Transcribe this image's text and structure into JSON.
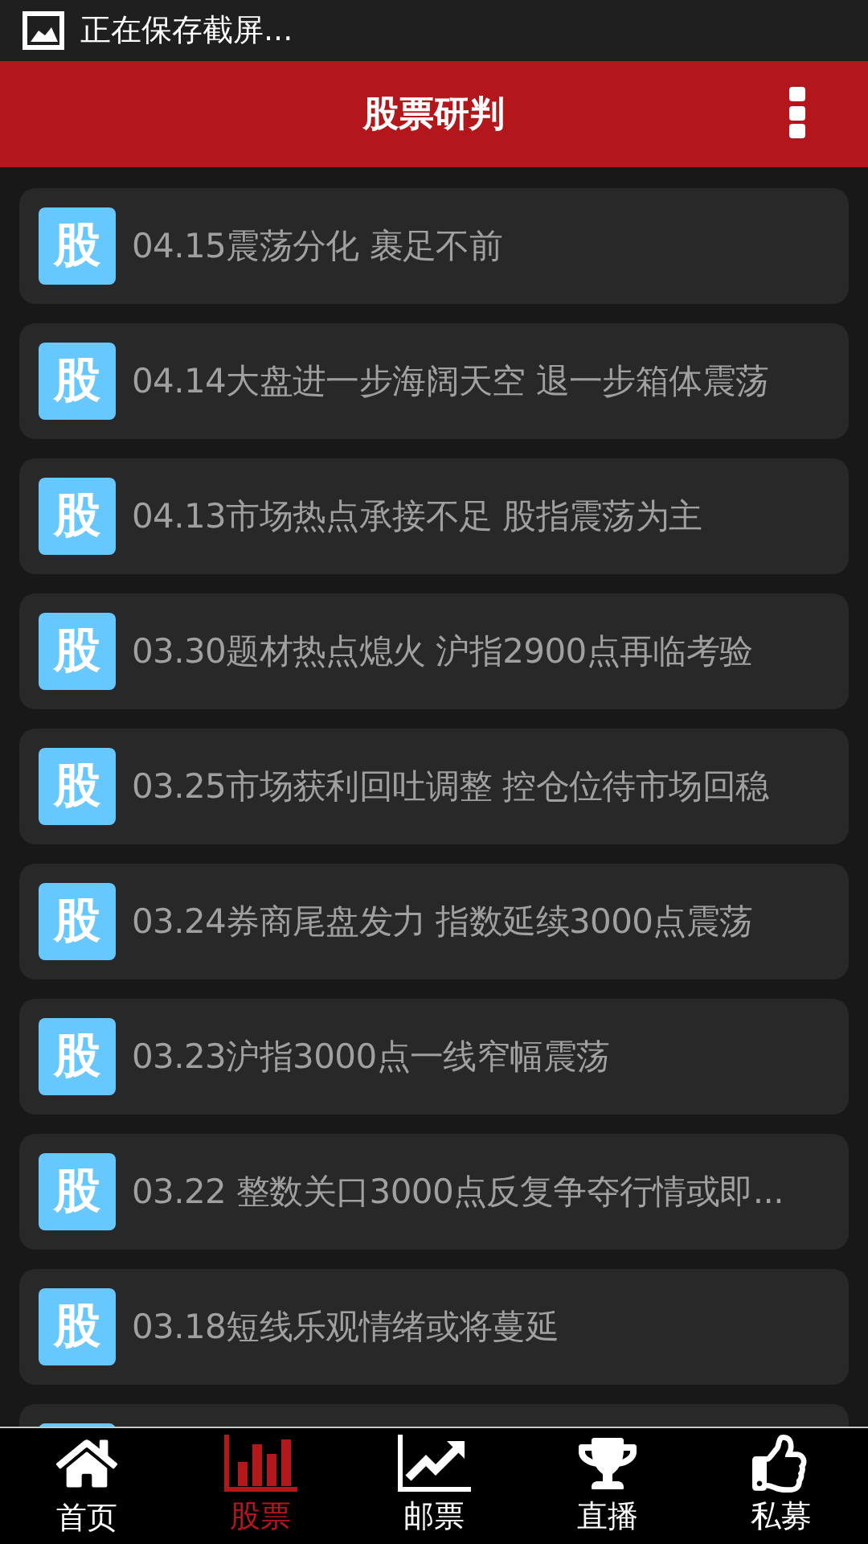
{
  "status_bar": {
    "notification": "正在保存截屏..."
  },
  "header": {
    "title": "股票研判"
  },
  "list": {
    "items": [
      {
        "kind": "article",
        "badge": "股",
        "title": "04.15震荡分化 裹足不前"
      },
      {
        "kind": "article",
        "badge": "股",
        "title": "04.14大盘进一步海阔天空 退一步箱体震荡"
      },
      {
        "kind": "article",
        "badge": "股",
        "title": "04.13市场热点承接不足 股指震荡为主"
      },
      {
        "kind": "article",
        "badge": "股",
        "title": "03.30题材热点熄火 沪指2900点再临考验"
      },
      {
        "kind": "article",
        "badge": "股",
        "title": "03.25市场获利回吐调整 控仓位待市场回稳"
      },
      {
        "kind": "article",
        "badge": "股",
        "title": "03.24券商尾盘发力 指数延续3000点震荡"
      },
      {
        "kind": "article",
        "badge": "股",
        "title": "03.23沪指3000点一线窄幅震荡"
      },
      {
        "kind": "article",
        "badge": "股",
        "title": "03.22 整数关口3000点反复争夺行情或即..."
      },
      {
        "kind": "article",
        "badge": "股",
        "title": "03.18短线乐观情绪或将蔓延"
      },
      {
        "kind": "partial"
      }
    ]
  },
  "bottom_nav": [
    {
      "kind": "home",
      "label": "首页",
      "selected": false
    },
    {
      "kind": "bars",
      "label": "股票",
      "selected": true
    },
    {
      "kind": "trend",
      "label": "邮票",
      "selected": false
    },
    {
      "kind": "trophy",
      "label": "直播",
      "selected": false
    },
    {
      "kind": "thumb",
      "label": "私募",
      "selected": false
    }
  ]
}
